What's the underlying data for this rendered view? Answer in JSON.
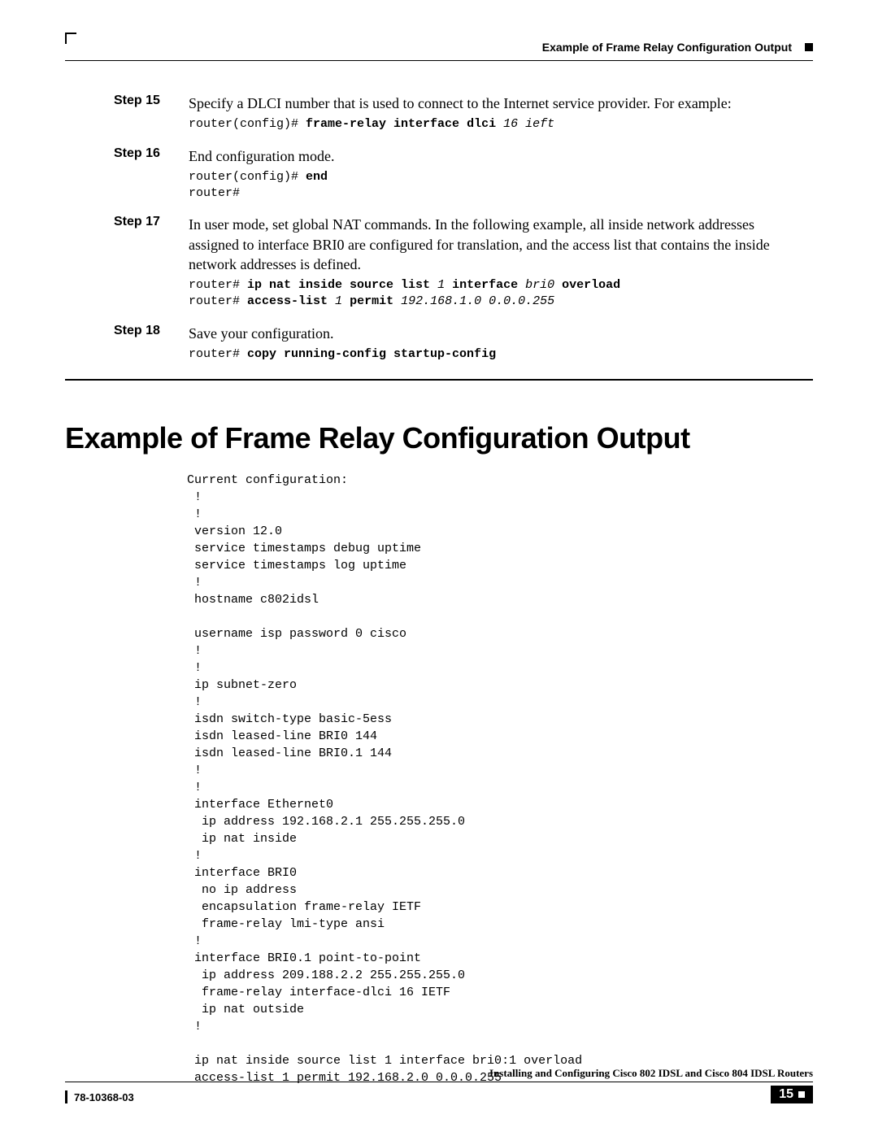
{
  "runningHead": "Example of Frame Relay Configuration Output",
  "steps": [
    {
      "label": "Step 15",
      "text": "Specify a DLCI number that is used to connect to the Internet service provider. For example:",
      "cli": [
        {
          "t": "router(config)# "
        },
        {
          "t": "frame-relay interface dlci ",
          "b": true
        },
        {
          "t": "16 ieft",
          "i": true
        }
      ]
    },
    {
      "label": "Step 16",
      "text": "End configuration mode.",
      "cli": [
        {
          "t": "router(config)# "
        },
        {
          "t": "end",
          "b": true
        },
        {
          "t": "\nrouter#"
        }
      ]
    },
    {
      "label": "Step 17",
      "text": "In user mode, set global NAT commands. In the following example, all inside network addresses assigned to interface BRI0 are configured for translation, and the access list that contains the inside network addresses is defined.",
      "cli": [
        {
          "t": "router# "
        },
        {
          "t": "ip nat inside source list ",
          "b": true
        },
        {
          "t": "1 ",
          "i": true
        },
        {
          "t": "interface ",
          "b": true
        },
        {
          "t": "bri0 ",
          "i": true
        },
        {
          "t": "overload",
          "b": true
        },
        {
          "t": "\nrouter# "
        },
        {
          "t": "access-list ",
          "b": true
        },
        {
          "t": "1 ",
          "i": true
        },
        {
          "t": "permit ",
          "b": true
        },
        {
          "t": "192.168.1.0 0.0.0.255",
          "i": true
        }
      ]
    },
    {
      "label": "Step 18",
      "text": "Save your configuration.",
      "cli": [
        {
          "t": "router# "
        },
        {
          "t": "copy running-config startup-config",
          "b": true
        }
      ]
    }
  ],
  "sectionTitle": "Example of Frame Relay Configuration Output",
  "configOutput": "Current configuration:\n !\n !\n version 12.0\n service timestamps debug uptime\n service timestamps log uptime\n !\n hostname c802idsl\n\n username isp password 0 cisco\n !\n !\n ip subnet-zero\n !\n isdn switch-type basic-5ess\n isdn leased-line BRI0 144\n isdn leased-line BRI0.1 144\n !\n !\n interface Ethernet0\n  ip address 192.168.2.1 255.255.255.0\n  ip nat inside\n !\n interface BRI0\n  no ip address\n  encapsulation frame-relay IETF\n  frame-relay lmi-type ansi\n !\n interface BRI0.1 point-to-point\n  ip address 209.188.2.2 255.255.255.0\n  frame-relay interface-dlci 16 IETF\n  ip nat outside\n !\n\n ip nat inside source list 1 interface bri0:1 overload\n access-list 1 permit 192.168.2.0 0.0.0.255",
  "footer": {
    "docTitle": "Installing and Configuring Cisco 802 IDSL and Cisco 804 IDSL Routers",
    "docNumber": "78-10368-03",
    "pageNumber": "15"
  }
}
